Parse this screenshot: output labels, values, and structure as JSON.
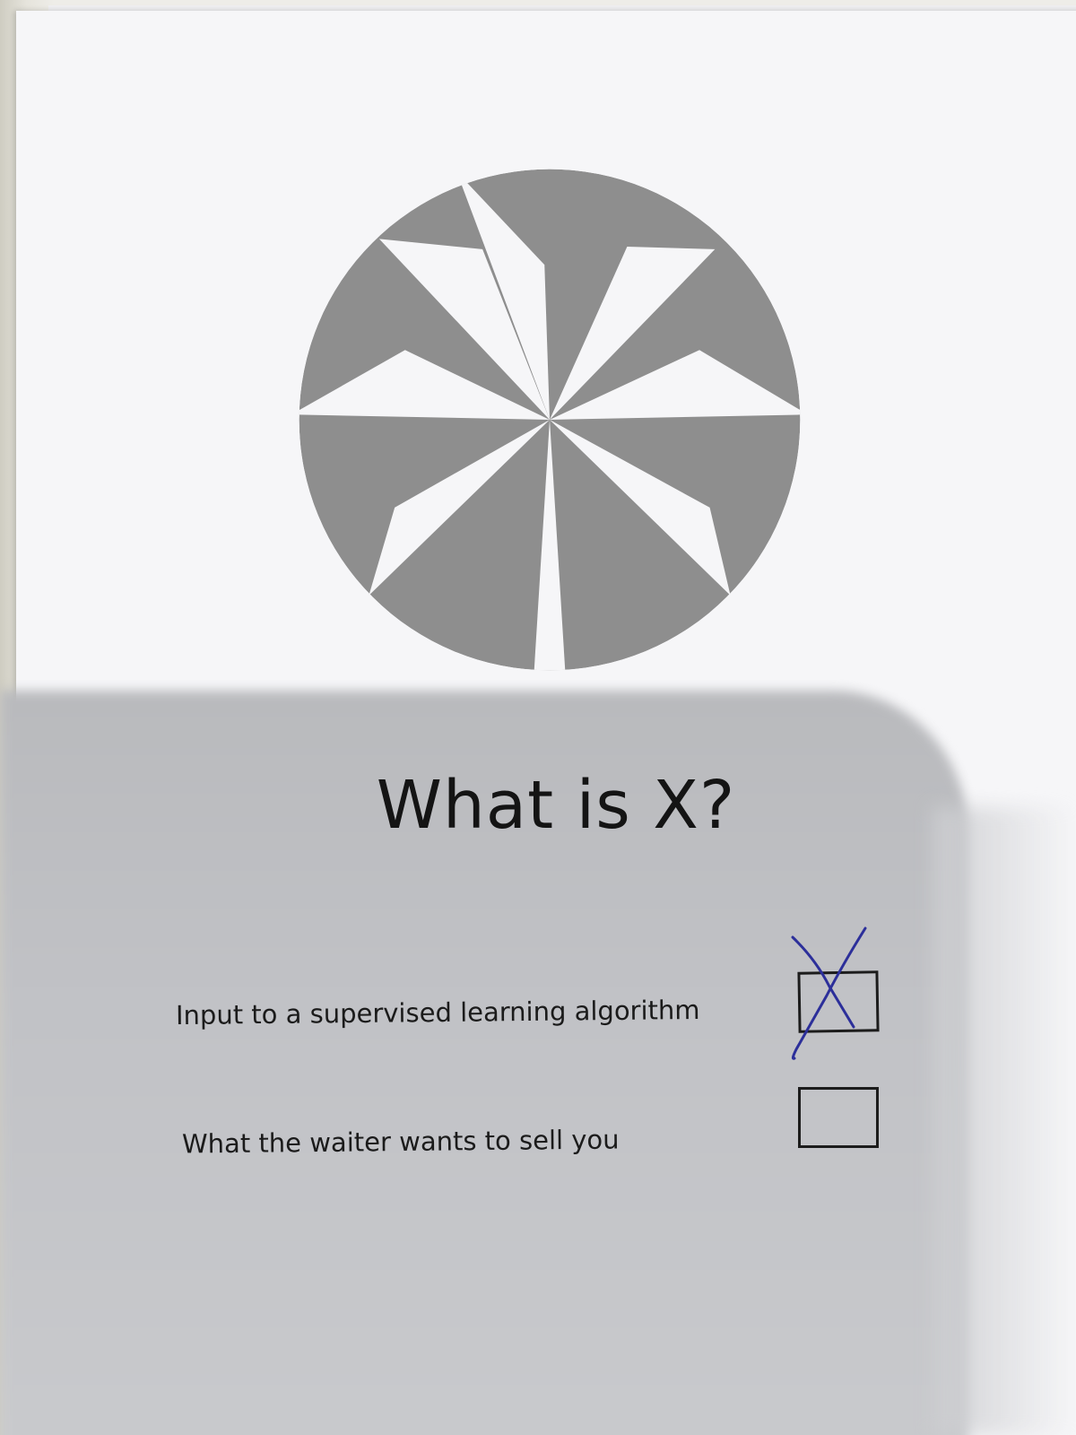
{
  "question": {
    "title": "What is X?"
  },
  "options": [
    {
      "label": "Input to a supervised learning algorithm",
      "checked": true
    },
    {
      "label": "What the waiter wants to sell you",
      "checked": false
    }
  ],
  "colors": {
    "logo_gray": "#8c8c8c",
    "pen_blue": "#2c2f9a",
    "paper": "#f6f6f8"
  },
  "icons": {
    "logo": "pinwheel-logo",
    "check_mark": "handwritten-x-mark"
  }
}
